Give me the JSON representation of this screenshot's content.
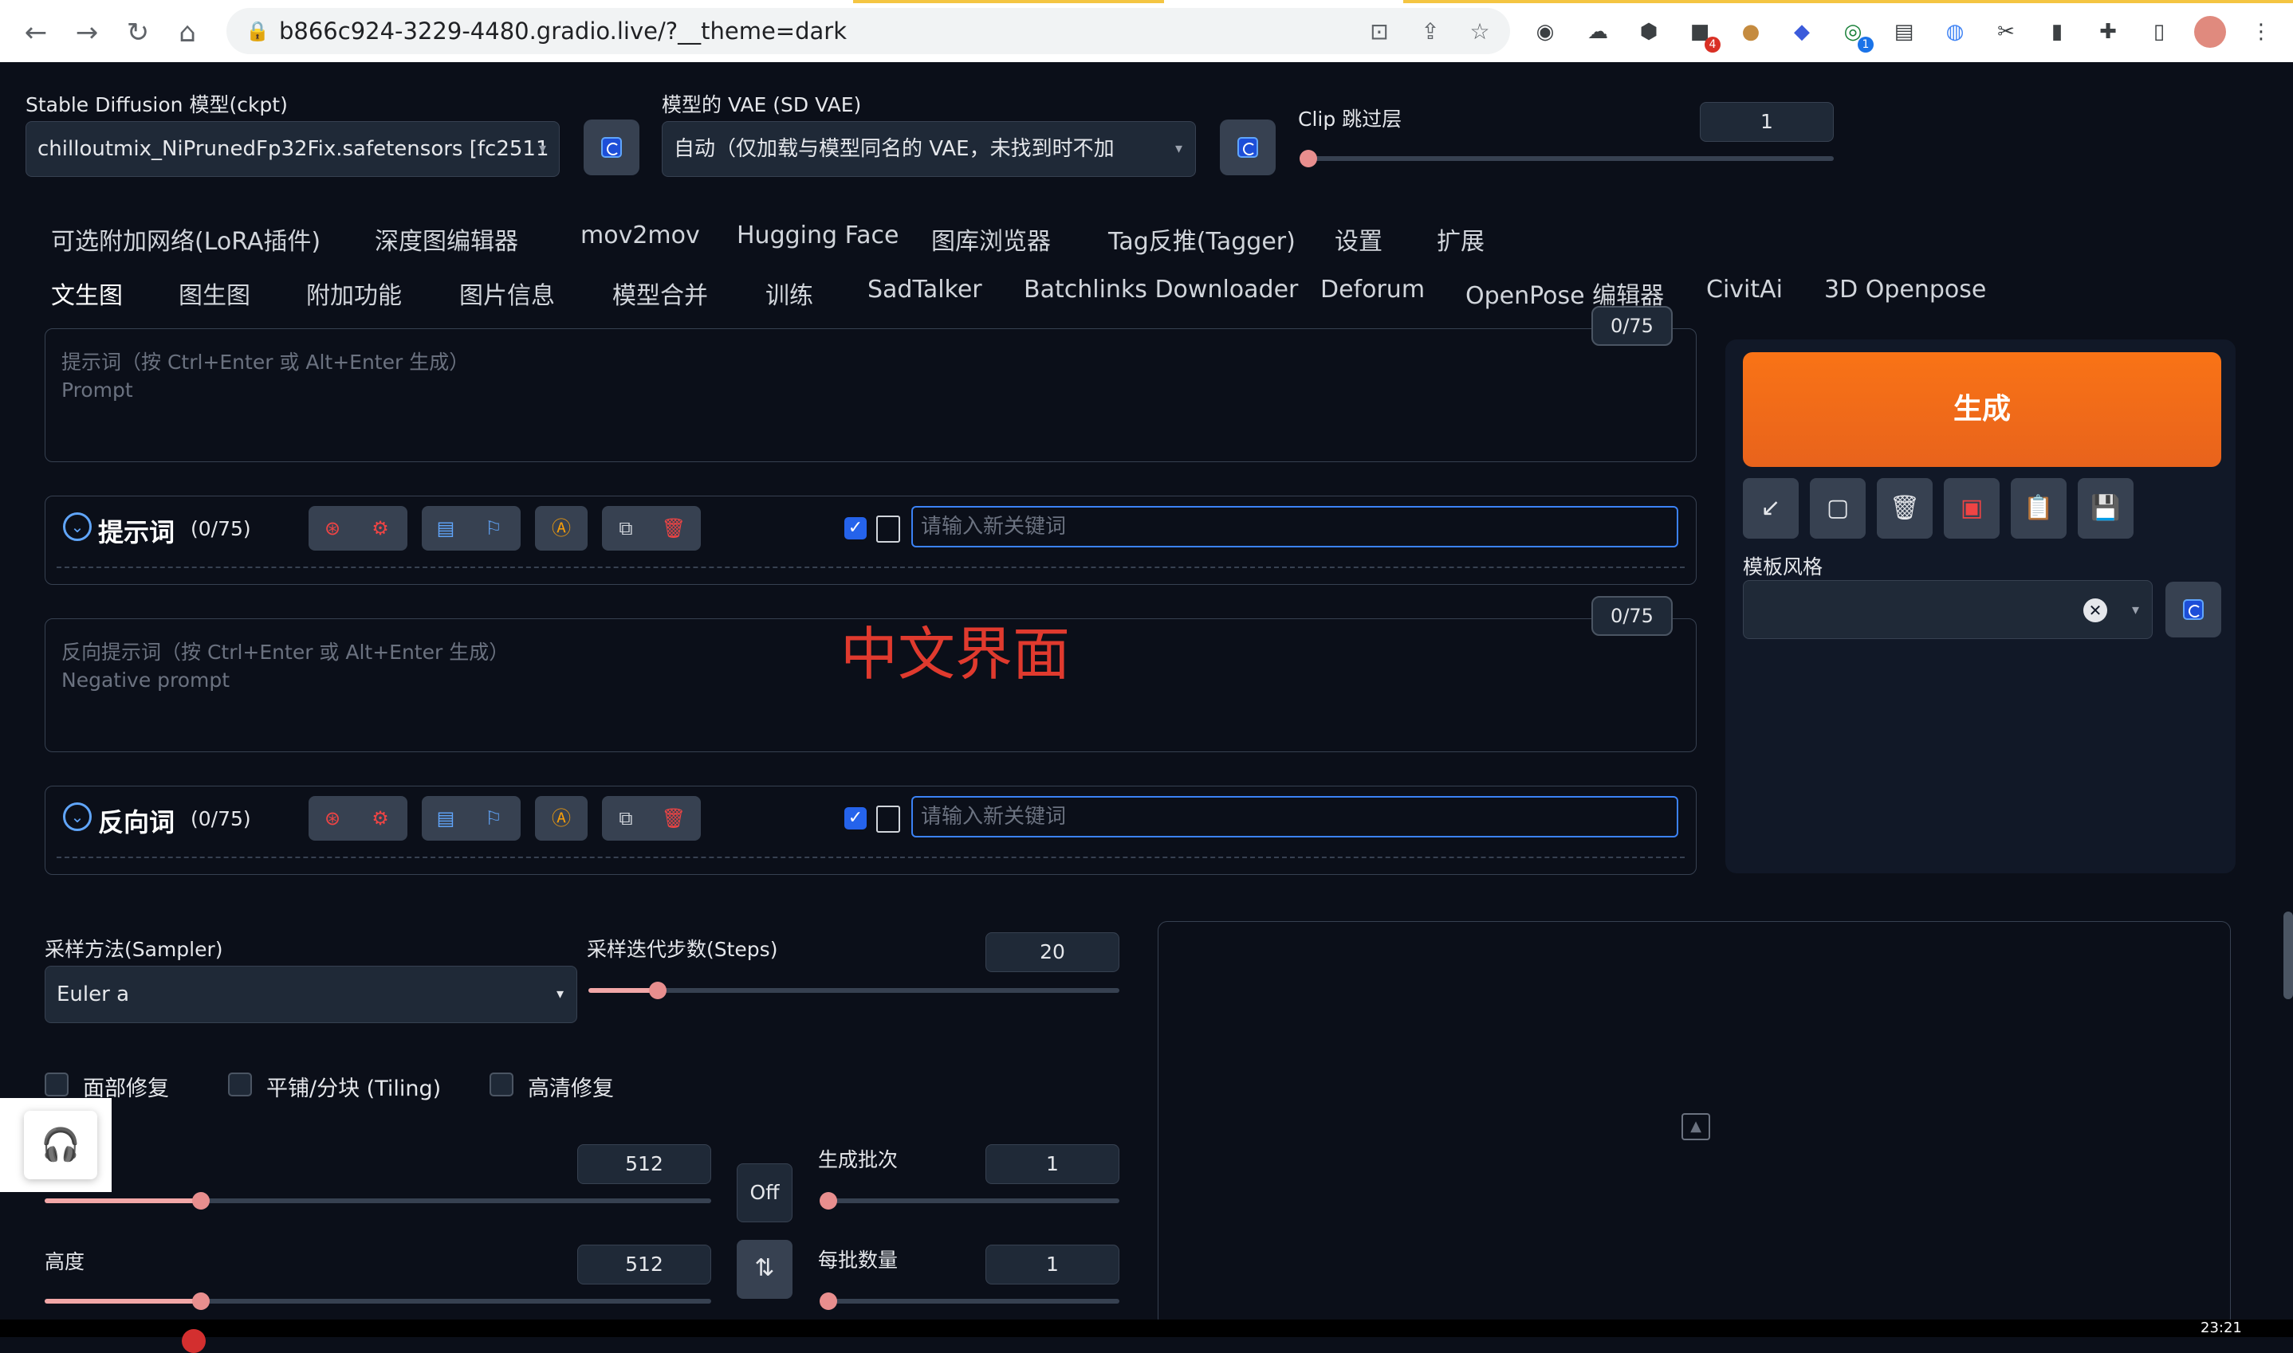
{
  "browser": {
    "url": "b866c924-3229-4480.gradio.live/?__theme=dark",
    "ext_badges": [
      "4",
      "1"
    ]
  },
  "top": {
    "model_label": "Stable Diffusion 模型(ckpt)",
    "model_value": "chilloutmix_NiPrunedFp32Fix.safetensors [fc2511",
    "vae_label": "模型的 VAE (SD VAE)",
    "vae_value": "自动（仅加载与模型同名的 VAE，未找到时不加",
    "clip_label": "Clip 跳过层",
    "clip_value": "1",
    "clip_fraction": 0.0
  },
  "tabs_row1": [
    "可选附加网络(LoRA插件)",
    "深度图编辑器",
    "mov2mov",
    "Hugging Face",
    "图库浏览器",
    "Tag反推(Tagger)",
    "设置",
    "扩展"
  ],
  "tabs_row2": [
    "文生图",
    "图生图",
    "附加功能",
    "图片信息",
    "模型合并",
    "训练",
    "SadTalker",
    "Batchlinks Downloader",
    "Deforum",
    "OpenPose 编辑器",
    "CivitAi",
    "3D Openpose"
  ],
  "prompt": {
    "placeholder_line1": "提示词（按 Ctrl+Enter 或 Alt+Enter 生成）",
    "placeholder_line2": "Prompt",
    "token_count": "0/75"
  },
  "prompt_helper": {
    "title": "提示词",
    "count": "(0/75)",
    "keyword_placeholder": "请输入新关键词"
  },
  "negative": {
    "placeholder_line1": "反向提示词（按 Ctrl+Enter 或 Alt+Enter 生成）",
    "placeholder_line2": "Negative prompt",
    "token_count": "0/75"
  },
  "negative_helper": {
    "title": "反向词",
    "count": "(0/75)",
    "keyword_placeholder": "请输入新关键词"
  },
  "overlay_text": "中文界面",
  "right": {
    "generate_label": "生成",
    "style_label": "模板风格"
  },
  "params": {
    "sampler_label": "采样方法(Sampler)",
    "sampler_value": "Euler a",
    "steps_label": "采样迭代步数(Steps)",
    "steps_value": "20",
    "steps_fraction": 0.13,
    "face_fix": "面部修复",
    "tiling": "平铺/分块 (Tiling)",
    "hires": "高清修复",
    "width_value": "512",
    "width_fraction": 0.235,
    "height_label": "高度",
    "height_value": "512",
    "height_fraction": 0.235,
    "off_label": "Off",
    "swap_icon": "⇅",
    "batch_count_label": "生成批次",
    "batch_count_value": "1",
    "batch_count_fraction": 0.0,
    "batch_size_label": "每批数量",
    "batch_size_value": "1",
    "batch_size_fraction": 0.0
  },
  "taskbar": {
    "time": "23:21"
  },
  "colors": {
    "accent": "#f97316",
    "background": "#0b0f19",
    "slider": "#e88e8e",
    "overlay_red": "#e03a2e"
  }
}
